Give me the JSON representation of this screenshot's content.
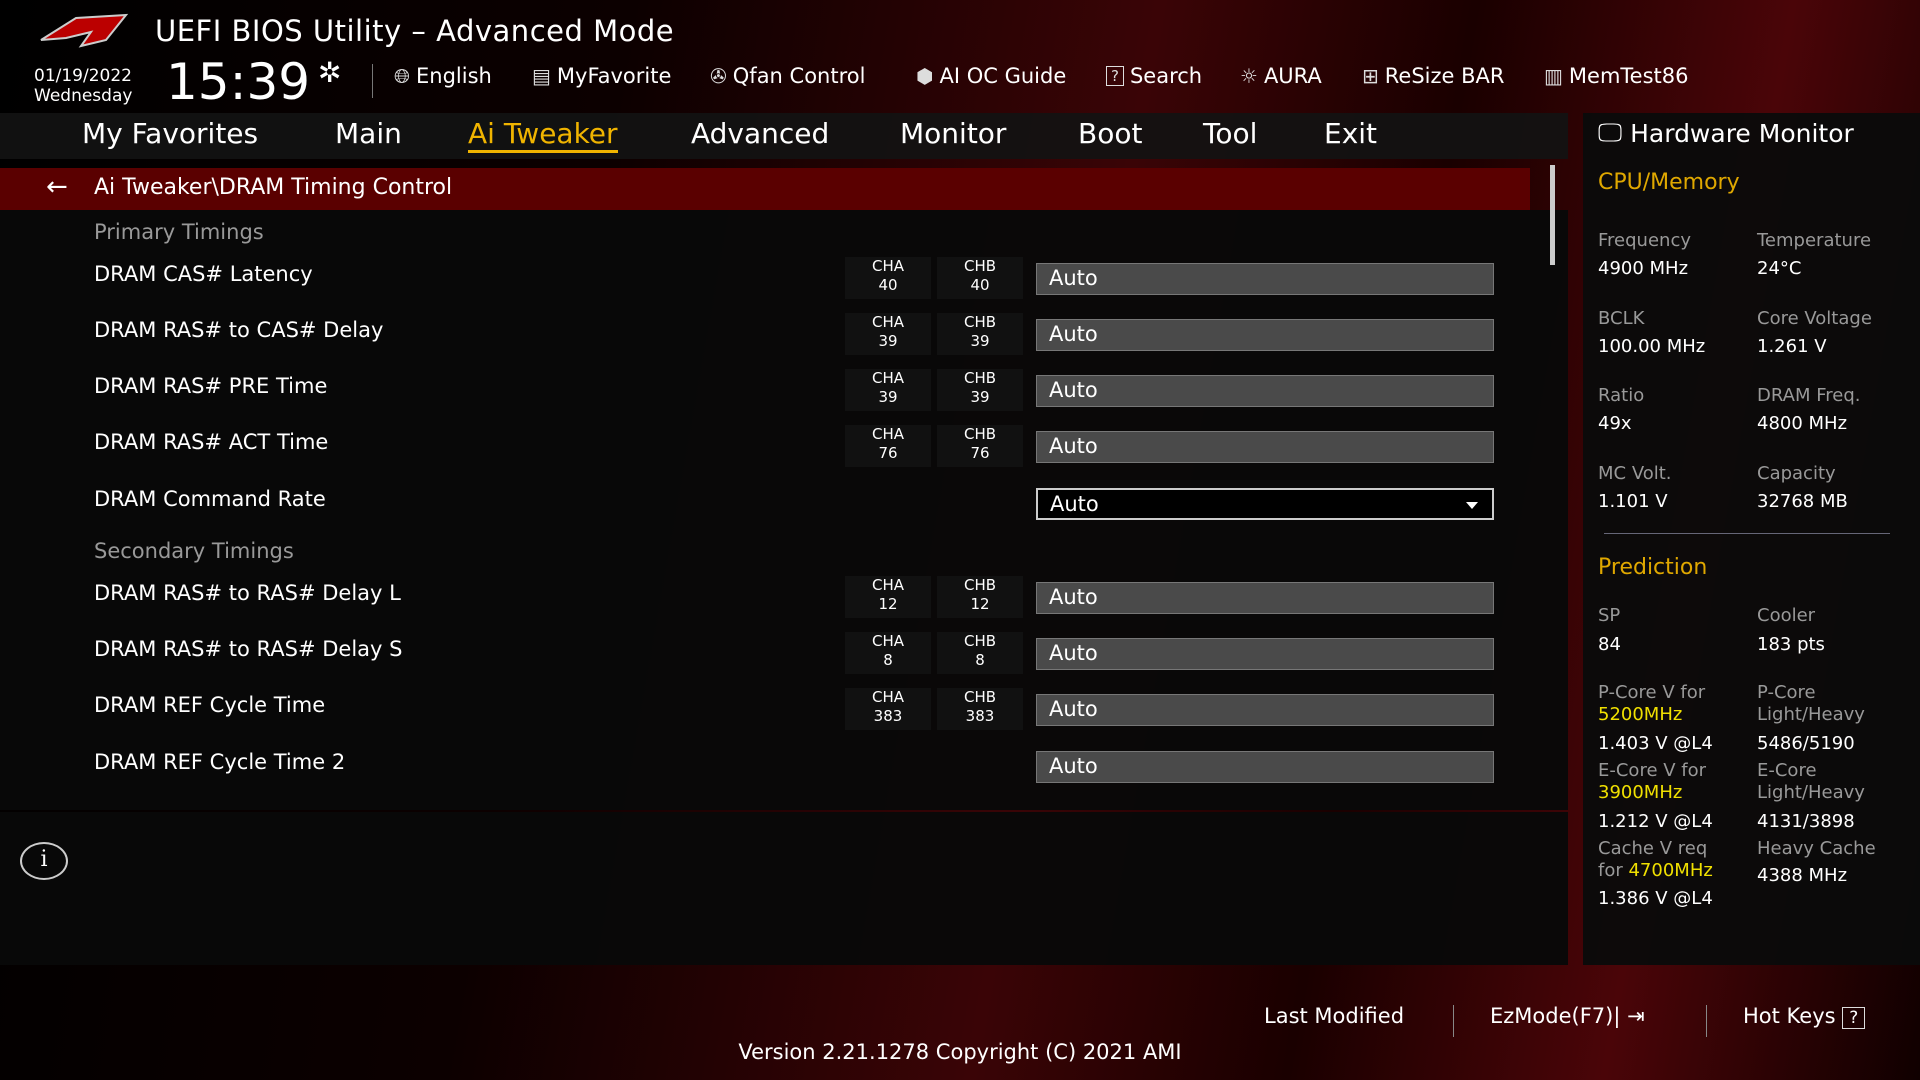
{
  "header": {
    "title": "UEFI BIOS Utility – Advanced Mode",
    "date": "01/19/2022",
    "day": "Wednesday",
    "time": "15:39"
  },
  "toolbar": [
    {
      "label": "English",
      "icon": "globe-icon"
    },
    {
      "label": "MyFavorite",
      "icon": "favorite-list-icon"
    },
    {
      "label": "Qfan Control",
      "icon": "fan-icon"
    },
    {
      "label": "AI OC Guide",
      "icon": "ai-chip-icon"
    },
    {
      "label": "Search",
      "icon": "help-search-icon"
    },
    {
      "label": "AURA",
      "icon": "aura-light-icon"
    },
    {
      "label": "ReSize BAR",
      "icon": "resize-bar-icon"
    },
    {
      "label": "MemTest86",
      "icon": "memory-icon"
    }
  ],
  "tabs": [
    "My Favorites",
    "Main",
    "Ai Tweaker",
    "Advanced",
    "Monitor",
    "Boot",
    "Tool",
    "Exit"
  ],
  "active_tab": "Ai Tweaker",
  "breadcrumb": "Ai Tweaker\\DRAM Timing Control",
  "sections": {
    "primary": "Primary Timings",
    "secondary": "Secondary Timings"
  },
  "channel_labels": {
    "a": "CHA",
    "b": "CHB"
  },
  "rows": [
    {
      "label": "DRAM CAS# Latency",
      "cha": "40",
      "chb": "40",
      "value": "Auto"
    },
    {
      "label": "DRAM RAS# to CAS# Delay",
      "cha": "39",
      "chb": "39",
      "value": "Auto"
    },
    {
      "label": "DRAM RAS# PRE Time",
      "cha": "39",
      "chb": "39",
      "value": "Auto"
    },
    {
      "label": "DRAM RAS# ACT Time",
      "cha": "76",
      "chb": "76",
      "value": "Auto"
    },
    {
      "label": "DRAM Command Rate",
      "value": "Auto"
    },
    {
      "label": "DRAM RAS# to RAS# Delay L",
      "cha": "12",
      "chb": "12",
      "value": "Auto"
    },
    {
      "label": "DRAM RAS# to RAS# Delay S",
      "cha": "8",
      "chb": "8",
      "value": "Auto"
    },
    {
      "label": "DRAM REF Cycle Time",
      "cha": "383",
      "chb": "383",
      "value": "Auto"
    },
    {
      "label": "DRAM REF Cycle Time 2",
      "value": "Auto"
    }
  ],
  "hw": {
    "title": "Hardware Monitor",
    "cpu_heading": "CPU/Memory",
    "cpu": [
      [
        "Frequency",
        "4900 MHz"
      ],
      [
        "Temperature",
        "24°C"
      ],
      [
        "BCLK",
        "100.00 MHz"
      ],
      [
        "Core Voltage",
        "1.261 V"
      ],
      [
        "Ratio",
        "49x"
      ],
      [
        "DRAM Freq.",
        "4800 MHz"
      ],
      [
        "MC Volt.",
        "1.101 V"
      ],
      [
        "Capacity",
        "32768 MB"
      ]
    ],
    "pred_heading": "Prediction",
    "sp_label": "SP",
    "sp": "84",
    "cooler_label": "Cooler",
    "cooler": "183 pts",
    "pcore_label": "P-Core V for",
    "pcore_freq": "5200MHz",
    "pcore_v": "1.403 V @L4",
    "pcore_lh_label1": "P-Core",
    "pcore_lh_label2": "Light/Heavy",
    "pcore_lh": "5486/5190",
    "ecore_label": "E-Core V for",
    "ecore_freq": "3900MHz",
    "ecore_v": "1.212 V @L4",
    "ecore_lh_label1": "E-Core",
    "ecore_lh_label2": "Light/Heavy",
    "ecore_lh": "4131/3898",
    "cache_label1": "Cache V req",
    "cache_label2": "for",
    "cache_freq": "4700MHz",
    "cache_v": "1.386 V @L4",
    "heavy_cache_label": "Heavy Cache",
    "heavy_cache": "4388 MHz"
  },
  "footer": {
    "last_modified": "Last Modified",
    "ezmode": "EzMode(F7)|",
    "hotkeys": "Hot Keys",
    "hotkeys_icon": "?",
    "version": "Version 2.21.1278 Copyright (C) 2021 AMI"
  },
  "colors": {
    "accent": "#f0b400",
    "crumb": "#5a0000",
    "highlight": "#f0e000"
  }
}
